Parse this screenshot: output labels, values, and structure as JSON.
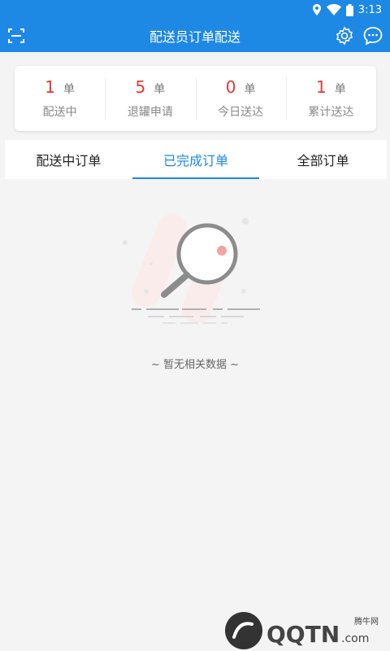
{
  "status_bar": {
    "time": "3:13"
  },
  "app_bar": {
    "title": "配送员订单配送"
  },
  "stats": [
    {
      "value": "1",
      "unit": "单",
      "label": "配送中"
    },
    {
      "value": "5",
      "unit": "单",
      "label": "退罐申请"
    },
    {
      "value": "0",
      "unit": "单",
      "label": "今日送达"
    },
    {
      "value": "1",
      "unit": "单",
      "label": "累计送达"
    }
  ],
  "tabs": [
    {
      "label": "配送中订单",
      "active": false
    },
    {
      "label": "已完成订单",
      "active": true
    },
    {
      "label": "全部订单",
      "active": false
    }
  ],
  "empty": {
    "text": "~ 暂无相关数据 ~"
  },
  "watermark": {
    "label": "腾牛网",
    "brand": "QQTN.com"
  },
  "colors": {
    "primary": "#1e88e5",
    "accent_red": "#e53935"
  }
}
